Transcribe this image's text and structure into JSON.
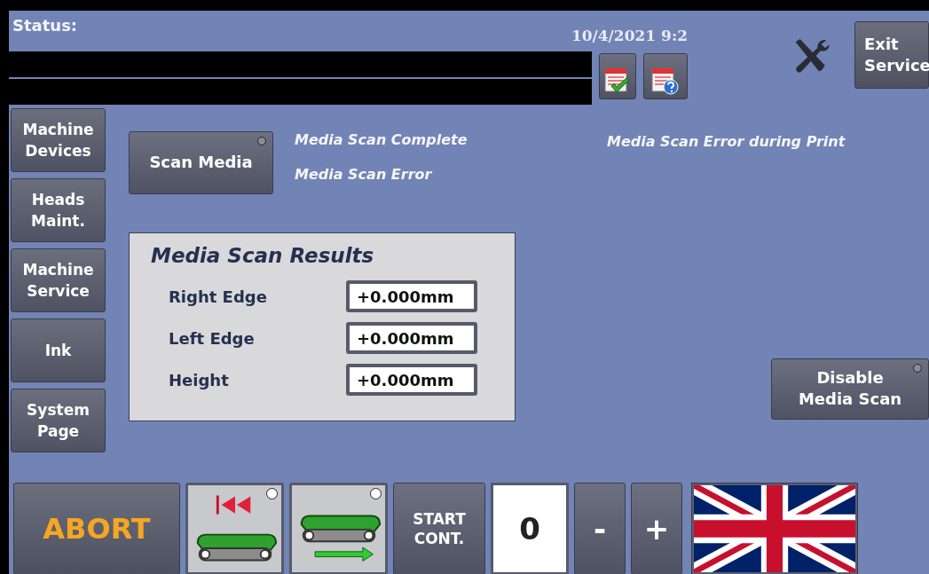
{
  "header": {
    "status_label": "Status:",
    "datetime": "10/4/2021 9:2",
    "exit_button": {
      "label": "Exit\nService"
    }
  },
  "sidebar": {
    "items": [
      {
        "label": "Machine\nDevices",
        "selected": false
      },
      {
        "label": "Heads\nMaint.",
        "selected": false
      },
      {
        "label": "Machine\nService",
        "selected": false
      },
      {
        "label": "Ink",
        "selected": false
      },
      {
        "label": "System\nPage",
        "selected": false
      }
    ]
  },
  "scan_button": {
    "label": "Scan Media",
    "indicator_on": false
  },
  "messages": [
    "Media Scan Complete",
    "Media Scan Error"
  ],
  "print_message": "Media Scan Error during Print",
  "results": {
    "title": "Media Scan Results",
    "rows": [
      {
        "label": "Right Edge",
        "value": "+0.000mm"
      },
      {
        "label": "Left Edge",
        "value": "+0.000mm"
      },
      {
        "label": "Height",
        "value": "+0.000mm"
      }
    ]
  },
  "disable_button": {
    "label": "Disable\nMedia Scan",
    "indicator_on": false
  },
  "bottom_bar": {
    "abort_label": "ABORT",
    "conveyor_buttons": [
      {
        "kind": "reverse",
        "indicator_on": true
      },
      {
        "kind": "forward",
        "indicator_on": true
      }
    ],
    "start_label": "START\nCONT.",
    "counter": "0",
    "minus_label": "-",
    "plus_label": "+"
  }
}
